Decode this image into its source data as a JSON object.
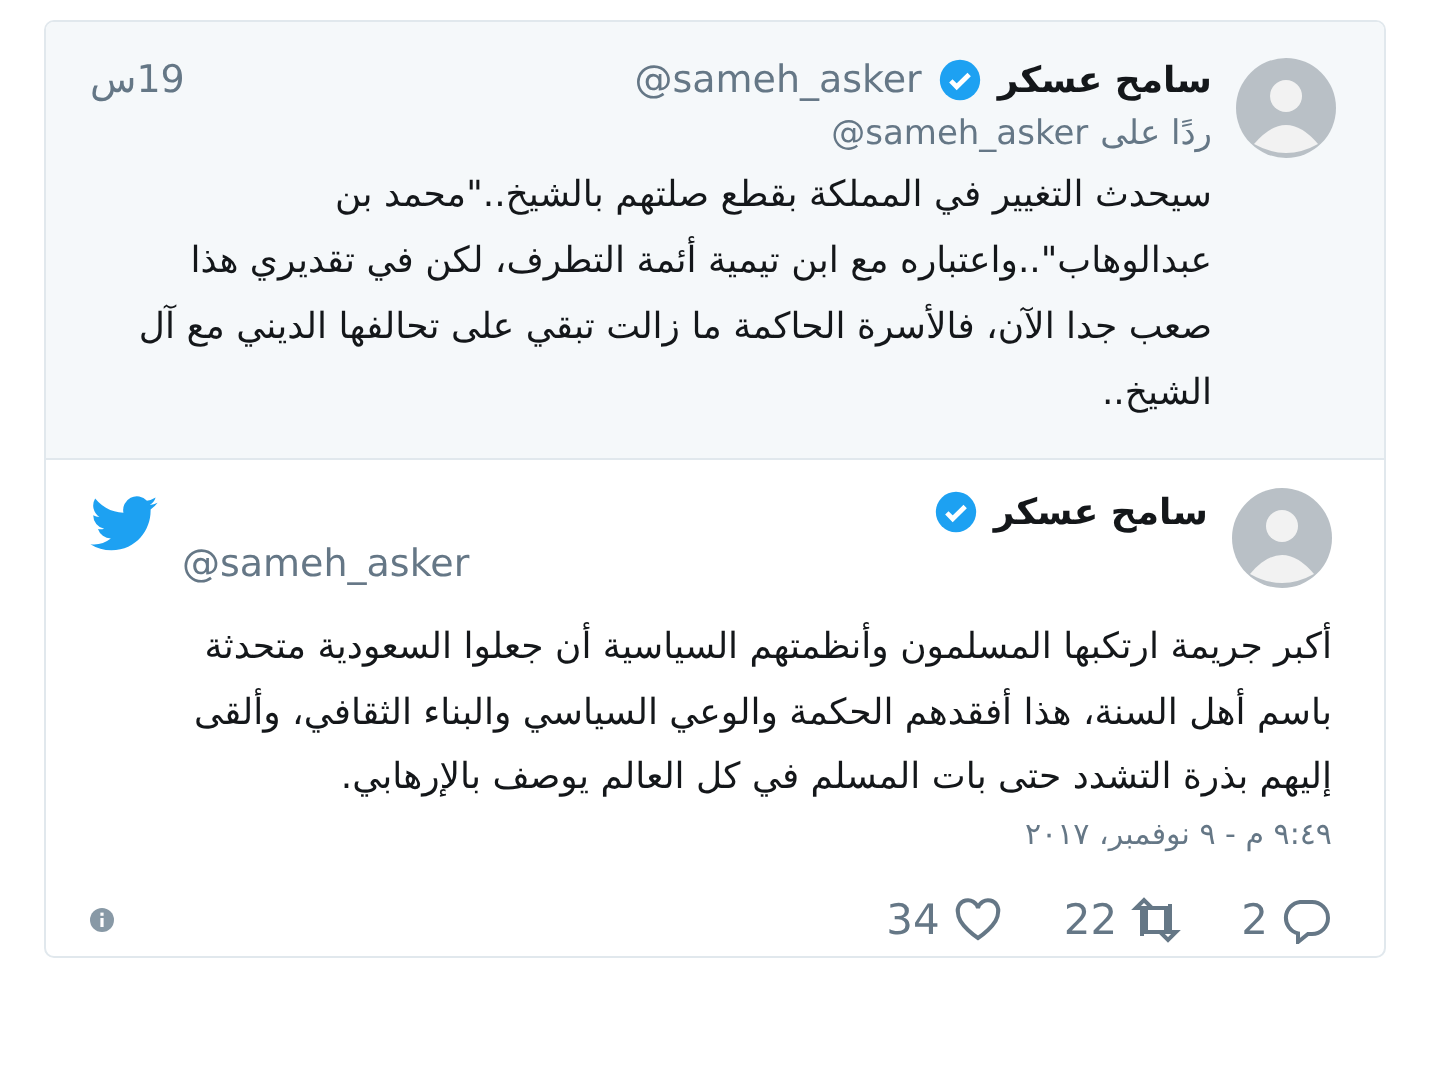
{
  "reply_tweet": {
    "author": {
      "name": "سامح عسكر",
      "verified": true,
      "handle": "@sameh_asker"
    },
    "time": "19س",
    "reply_to_label": "ردًا على",
    "reply_to_handle": "@sameh_asker",
    "text": "سيحدث التغيير في المملكة بقطع صلتهم بالشيخ..\"محمد بن عبدالوهاب\"..واعتباره مع ابن تيمية أئمة التطرف، لكن في تقديري هذا صعب جدا الآن، فالأسرة الحاكمة ما زالت تبقي على تحالفها الديني مع آل الشيخ.."
  },
  "tweet": {
    "author": {
      "name": "سامح عسكر",
      "verified": true,
      "handle": "@sameh_asker"
    },
    "text": "أكبر جريمة ارتكبها المسلمون وأنظمتهم السياسية أن جعلوا السعودية متحدثة باسم أهل السنة، هذا أفقدهم الحكمة والوعي السياسي والبناء الثقافي، وألقى إليهم بذرة التشدد حتى بات المسلم في كل العالم يوصف بالإرهابي.",
    "timestamp": "٩:٤٩ م - ٩ نوفمبر، ٢٠١٧",
    "actions": [
      {
        "kind": "reply",
        "count": "2"
      },
      {
        "kind": "retweet",
        "count": "22"
      },
      {
        "kind": "like",
        "count": "34"
      }
    ]
  }
}
